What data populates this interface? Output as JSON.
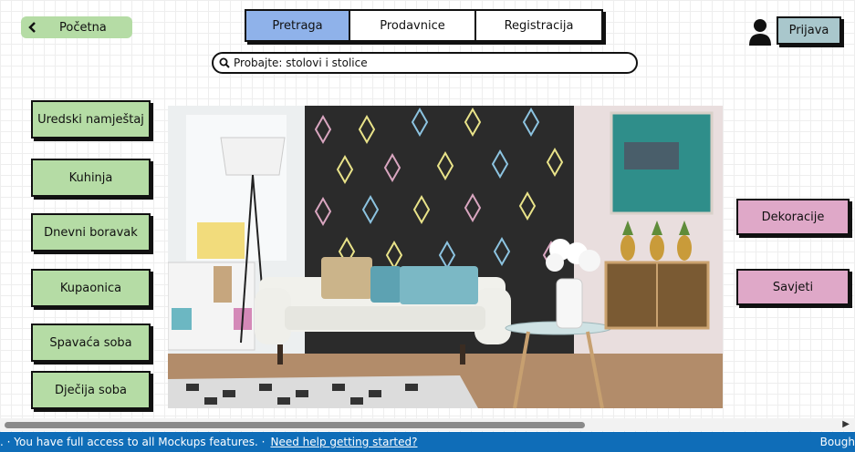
{
  "nav": {
    "home_label": "Početna"
  },
  "tabs": [
    {
      "label": "Pretraga",
      "active": true
    },
    {
      "label": "Prodavnice",
      "active": false
    },
    {
      "label": "Registracija",
      "active": false
    }
  ],
  "search": {
    "placeholder": "Probajte: stolovi i stolice"
  },
  "account": {
    "login_label": "Prijava"
  },
  "categories": [
    {
      "label": "Uredski namještaj"
    },
    {
      "label": "Kuhinja"
    },
    {
      "label": "Dnevni boravak"
    },
    {
      "label": "Kupaonica"
    },
    {
      "label": "Spavaća soba"
    },
    {
      "label": "Dječija soba"
    }
  ],
  "side_links": [
    {
      "label": "Dekoracije"
    },
    {
      "label": "Savjeti"
    }
  ],
  "statusbar": {
    "message": ". · You have full access to all Mockups features. ·",
    "help_link": "Need help getting started?",
    "right_text": "Bough"
  },
  "colors": {
    "category_green": "#b5dca5",
    "tab_active_blue": "#8fb2ea",
    "side_pink": "#dfa8c8",
    "status_blue": "#0f6db8"
  }
}
